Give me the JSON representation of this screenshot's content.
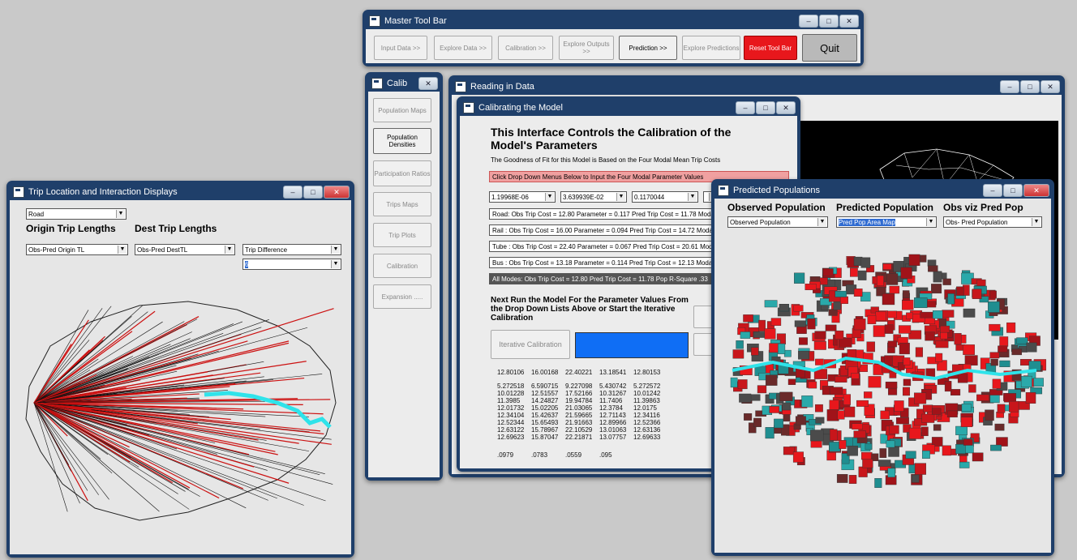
{
  "master": {
    "title": "Master Tool Bar",
    "buttons": [
      "Input Data >>",
      "Explore Data >>",
      "Calibration >>",
      "Explore Outputs >>",
      "Prediction >>",
      "Explore Predictions",
      "Reset Tool Bar",
      "Quit"
    ]
  },
  "calib": {
    "title": "Calib",
    "buttons": [
      "Population Maps",
      "Population Densities",
      "Participation Ratios",
      "Trips Maps",
      "Trip Plots",
      "Calibration",
      "Expansion ....."
    ]
  },
  "reading": {
    "title": "Reading in Data"
  },
  "calibrating": {
    "title": "Calibrating the Model",
    "heading": "This Interface Controls the Calibration of the Model's Parameters",
    "subtitle": "The Goodness of Fit for this Model is Based on the Four Modal Mean Trip Costs",
    "banner": "Click Drop Down Menus Below to Input the Four Modal Parameter Values",
    "params": [
      "1.19968E-06",
      "3.639939E-02",
      "0.1170044"
    ],
    "rows": [
      "Road: Obs Trip Cost = 12.80 Parameter = 0.117 Pred Trip Cost = 11.78 Modal",
      "Rail : Obs Trip Cost = 16.00 Parameter = 0.094 Pred Trip Cost = 14.72 Modal",
      "Tube : Obs Trip Cost = 22.40 Parameter = 0.067 Pred Trip Cost = 20.61 Modal",
      "Bus : Obs Trip Cost = 13.18 Parameter = 0.114 Pred Trip Cost = 12.13 Modal",
      "All Modes: Obs Trip Cost = 12.80 Pred Trip Cost = 11.78 Pop R-Square .33"
    ],
    "next_run": "Next Run the Model For the Parameter Values From the Drop Down Lists Above or Start the Iterative Calibration",
    "iterative_button": "Iterative Calibration",
    "table_head": [
      "12.80106",
      "16.00168",
      "22.40221",
      "13.18541",
      "12.80153"
    ],
    "table_cols": [
      "5.272518\n10.01228\n11.3985\n12.01732\n12.34104\n12.52344\n12.63122\n12.69623",
      "6.590715\n12.51557\n14.24827\n15.02205\n15.42637\n15.65493\n15.78967\n15.87047",
      "9.227098\n17.52166\n19.94784\n21.03065\n21.59665\n21.91663\n22.10529\n22.21871",
      "5.430742\n10.31267\n11.7406\n12.3784\n12.71143\n12.89966\n13.01063\n13.07757",
      "5.272572\n10.01242\n11.39863\n12.0175\n12.34116\n12.52366\n12.63136\n12.69633"
    ],
    "table_foot": [
      ".0979",
      ".0783",
      ".0559",
      ".095"
    ]
  },
  "trip": {
    "title": "Trip Location and Interaction Displays",
    "mode": "Road",
    "origin_label": "Origin Trip Lengths",
    "dest_label": "Dest Trip Lengths",
    "origin_select": "Obs-Pred Origin TL",
    "dest_select": "Obs-Pred DestTL",
    "diff_select": "Trip Difference",
    "diff_value": "6"
  },
  "predicted": {
    "title": "Predicted Populations",
    "headings": [
      "Observed Population",
      "Predicted Population",
      "Obs viz Pred Pop"
    ],
    "selects": [
      "Observed Population",
      "Pred Pop Area Map",
      "Obs- Pred Population"
    ]
  },
  "colors": {
    "accent_red": "#e8171c",
    "blue_fill": "#0f6ef5",
    "teal": "#2aa9aa",
    "cyan_river": "#2fe3ea"
  }
}
